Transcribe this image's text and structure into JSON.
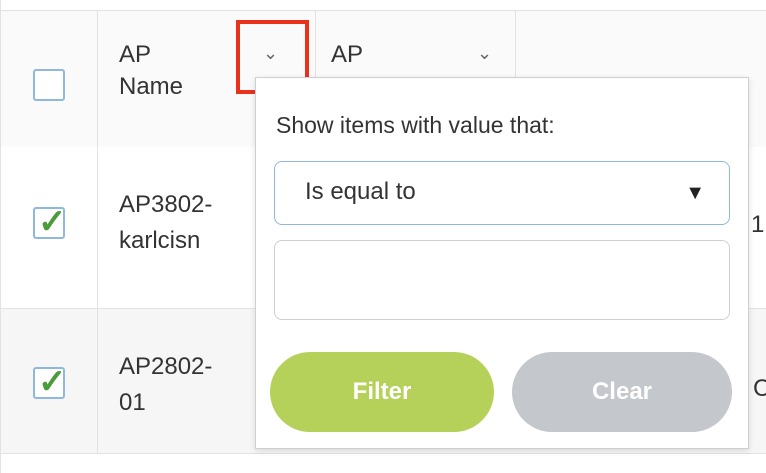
{
  "table": {
    "columns": [
      {
        "label_line1": "AP",
        "label_line2": "Name"
      },
      {
        "label_line1": "AP"
      }
    ],
    "rows": [
      {
        "checked": true,
        "name_line1": "AP3802-",
        "name_line2": "karlcisn",
        "cut_value": "1"
      },
      {
        "checked": true,
        "name_line1": "AP2802-",
        "name_line2": "01",
        "cut_value": "C"
      }
    ],
    "chevron_glyph": "⌄"
  },
  "filter_popup": {
    "title": "Show items with value that:",
    "operator_selected": "Is equal to",
    "value": "",
    "filter_button": "Filter",
    "clear_button": "Clear"
  },
  "colors": {
    "filter_button": "#b6d15a",
    "clear_button": "#c4c7cc",
    "highlight": "#e8321e",
    "checkmark": "#4a9b3a"
  }
}
